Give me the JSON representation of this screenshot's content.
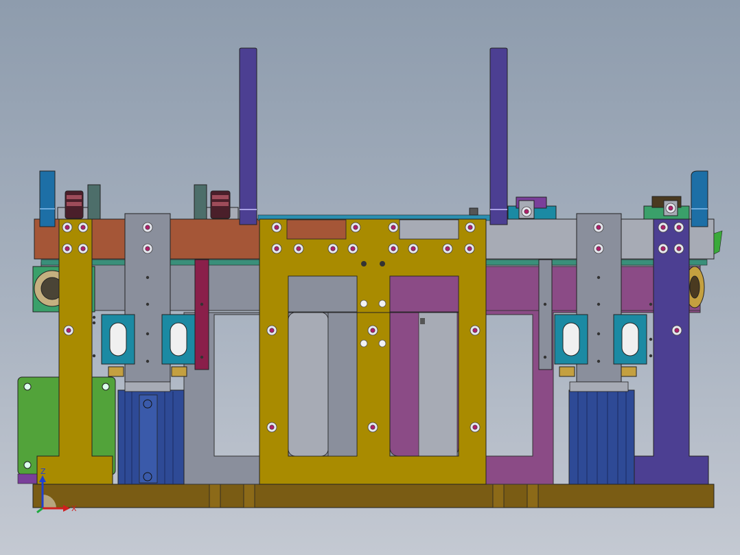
{
  "viewport": {
    "background_top": "#8e9cad",
    "background_bottom": "#c4c9d2"
  },
  "assembly": {
    "part_colors": {
      "base_plate": "#7a5c14",
      "gold_plate": "#a98b00",
      "gold_dark": "#8a7000",
      "copper_rail": "#a55637",
      "gray_steel": "#8a8f9c",
      "gray_light": "#a7abb5",
      "purple_guide": "#4c3f92",
      "magenta_panel": "#8b4b86",
      "teal_block": "#1b8aa3",
      "blue_cylinder": "#2e4a96",
      "green_motor": "#52a33a",
      "lever_blue": "#1d6fa6",
      "wheel_dark": "#4a1f2a",
      "wheel_red": "#9e4c5a",
      "maroon_bar": "#8a1f4a",
      "bolt_head": "#e8e8f0",
      "bolt_core": "#b0206a"
    }
  },
  "triad": {
    "z_label": "Z",
    "x_label": "X",
    "z_color": "#1f3fd0",
    "x_color": "#d01f1f",
    "y_color": "#1faa3f"
  }
}
